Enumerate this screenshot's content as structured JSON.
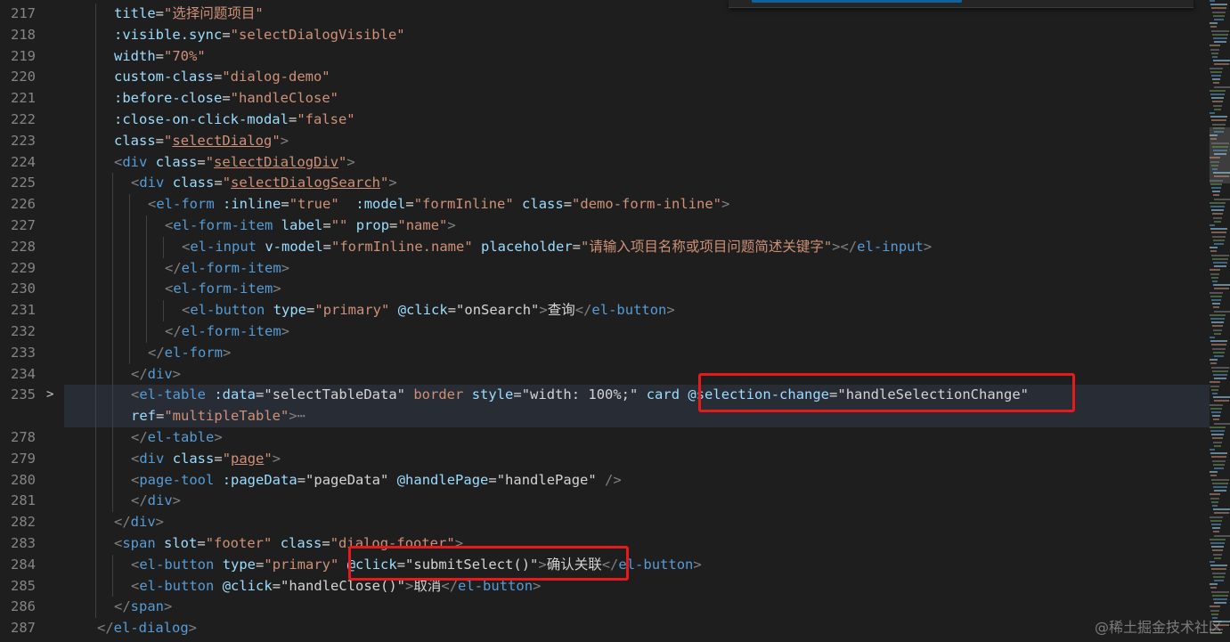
{
  "editor": {
    "lines": [
      {
        "num": "217",
        "fold": "",
        "indent": 2,
        "tokens": [
          {
            "c": "a",
            "t": "title"
          },
          {
            "c": "x",
            "t": "="
          },
          {
            "c": "s",
            "t": "\"选择问题项目\""
          }
        ]
      },
      {
        "num": "218",
        "fold": "",
        "indent": 2,
        "tokens": [
          {
            "c": "a",
            "t": ":visible.sync"
          },
          {
            "c": "x",
            "t": "="
          },
          {
            "c": "s",
            "t": "\"selectDialogVisible\""
          }
        ]
      },
      {
        "num": "219",
        "fold": "",
        "indent": 2,
        "tokens": [
          {
            "c": "a",
            "t": "width"
          },
          {
            "c": "x",
            "t": "="
          },
          {
            "c": "s",
            "t": "\"70%\""
          }
        ]
      },
      {
        "num": "220",
        "fold": "",
        "indent": 2,
        "tokens": [
          {
            "c": "a",
            "t": "custom-class"
          },
          {
            "c": "x",
            "t": "="
          },
          {
            "c": "s",
            "t": "\"dialog-demo\""
          }
        ]
      },
      {
        "num": "221",
        "fold": "",
        "indent": 2,
        "tokens": [
          {
            "c": "a",
            "t": ":before-close"
          },
          {
            "c": "x",
            "t": "="
          },
          {
            "c": "s",
            "t": "\"handleClose\""
          }
        ]
      },
      {
        "num": "222",
        "fold": "",
        "indent": 2,
        "tokens": [
          {
            "c": "a",
            "t": ":close-on-click-modal"
          },
          {
            "c": "x",
            "t": "="
          },
          {
            "c": "s",
            "t": "\"false\""
          }
        ]
      },
      {
        "num": "223",
        "fold": "",
        "indent": 2,
        "tokens": [
          {
            "c": "a",
            "t": "class"
          },
          {
            "c": "x",
            "t": "="
          },
          {
            "c": "s",
            "t": "\""
          },
          {
            "c": "s u",
            "t": "selectDialog"
          },
          {
            "c": "s",
            "t": "\""
          },
          {
            "c": "p",
            "t": ">"
          }
        ]
      },
      {
        "num": "224",
        "fold": "",
        "indent": 2,
        "tokens": [
          {
            "c": "p",
            "t": "<"
          },
          {
            "c": "t",
            "t": "div"
          },
          {
            "c": "x",
            "t": " "
          },
          {
            "c": "a",
            "t": "class"
          },
          {
            "c": "x",
            "t": "="
          },
          {
            "c": "s",
            "t": "\""
          },
          {
            "c": "s u",
            "t": "selectDialogDiv"
          },
          {
            "c": "s",
            "t": "\""
          },
          {
            "c": "p",
            "t": ">"
          }
        ]
      },
      {
        "num": "225",
        "fold": "",
        "indent": 3,
        "tokens": [
          {
            "c": "p",
            "t": "<"
          },
          {
            "c": "t",
            "t": "div"
          },
          {
            "c": "x",
            "t": " "
          },
          {
            "c": "a",
            "t": "class"
          },
          {
            "c": "x",
            "t": "="
          },
          {
            "c": "s",
            "t": "\""
          },
          {
            "c": "s u",
            "t": "selectDialogSearch"
          },
          {
            "c": "s",
            "t": "\""
          },
          {
            "c": "p",
            "t": ">"
          }
        ]
      },
      {
        "num": "226",
        "fold": "",
        "indent": 4,
        "tokens": [
          {
            "c": "p",
            "t": "<"
          },
          {
            "c": "t",
            "t": "el-form"
          },
          {
            "c": "x",
            "t": " "
          },
          {
            "c": "a",
            "t": ":inline"
          },
          {
            "c": "x",
            "t": "="
          },
          {
            "c": "s",
            "t": "\"true\""
          },
          {
            "c": "x",
            "t": "  "
          },
          {
            "c": "a",
            "t": ":model"
          },
          {
            "c": "x",
            "t": "="
          },
          {
            "c": "s",
            "t": "\"formInline\""
          },
          {
            "c": "x",
            "t": " "
          },
          {
            "c": "a",
            "t": "class"
          },
          {
            "c": "x",
            "t": "="
          },
          {
            "c": "s",
            "t": "\"demo-form-inline\""
          },
          {
            "c": "p",
            "t": ">"
          }
        ]
      },
      {
        "num": "227",
        "fold": "",
        "indent": 5,
        "tokens": [
          {
            "c": "p",
            "t": "<"
          },
          {
            "c": "t",
            "t": "el-form-item"
          },
          {
            "c": "x",
            "t": " "
          },
          {
            "c": "a",
            "t": "label"
          },
          {
            "c": "x",
            "t": "="
          },
          {
            "c": "s",
            "t": "\"\""
          },
          {
            "c": "x",
            "t": " "
          },
          {
            "c": "a",
            "t": "prop"
          },
          {
            "c": "x",
            "t": "="
          },
          {
            "c": "s",
            "t": "\"name\""
          },
          {
            "c": "p",
            "t": ">"
          }
        ]
      },
      {
        "num": "228",
        "fold": "",
        "indent": 6,
        "tokens": [
          {
            "c": "p",
            "t": "<"
          },
          {
            "c": "t",
            "t": "el-input"
          },
          {
            "c": "x",
            "t": " "
          },
          {
            "c": "a",
            "t": "v-model"
          },
          {
            "c": "x",
            "t": "="
          },
          {
            "c": "s",
            "t": "\"formInline.name\""
          },
          {
            "c": "x",
            "t": " "
          },
          {
            "c": "a",
            "t": "placeholder"
          },
          {
            "c": "x",
            "t": "="
          },
          {
            "c": "s",
            "t": "\"请输入项目名称或项目问题简述关键字\""
          },
          {
            "c": "p",
            "t": "></"
          },
          {
            "c": "t",
            "t": "el-input"
          },
          {
            "c": "p",
            "t": ">"
          }
        ]
      },
      {
        "num": "229",
        "fold": "",
        "indent": 5,
        "tokens": [
          {
            "c": "p",
            "t": "</"
          },
          {
            "c": "t",
            "t": "el-form-item"
          },
          {
            "c": "p",
            "t": ">"
          }
        ]
      },
      {
        "num": "230",
        "fold": "",
        "indent": 5,
        "tokens": [
          {
            "c": "p",
            "t": "<"
          },
          {
            "c": "t",
            "t": "el-form-item"
          },
          {
            "c": "p",
            "t": ">"
          }
        ]
      },
      {
        "num": "231",
        "fold": "",
        "indent": 6,
        "tokens": [
          {
            "c": "p",
            "t": "<"
          },
          {
            "c": "t",
            "t": "el-button"
          },
          {
            "c": "x",
            "t": " "
          },
          {
            "c": "a",
            "t": "type"
          },
          {
            "c": "x",
            "t": "="
          },
          {
            "c": "s",
            "t": "\"primary\""
          },
          {
            "c": "x",
            "t": " "
          },
          {
            "c": "a",
            "t": "@click"
          },
          {
            "c": "x",
            "t": "="
          },
          {
            "c": "x",
            "t": "\"onSearch\""
          },
          {
            "c": "p",
            "t": ">"
          },
          {
            "c": "x",
            "t": "查询"
          },
          {
            "c": "p",
            "t": "</"
          },
          {
            "c": "t",
            "t": "el-button"
          },
          {
            "c": "p",
            "t": ">"
          }
        ]
      },
      {
        "num": "232",
        "fold": "",
        "indent": 5,
        "tokens": [
          {
            "c": "p",
            "t": "</"
          },
          {
            "c": "t",
            "t": "el-form-item"
          },
          {
            "c": "p",
            "t": ">"
          }
        ]
      },
      {
        "num": "233",
        "fold": "",
        "indent": 4,
        "tokens": [
          {
            "c": "p",
            "t": "</"
          },
          {
            "c": "t",
            "t": "el-form"
          },
          {
            "c": "p",
            "t": ">"
          }
        ]
      },
      {
        "num": "234",
        "fold": "",
        "indent": 3,
        "tokens": [
          {
            "c": "p",
            "t": "</"
          },
          {
            "c": "t",
            "t": "div"
          },
          {
            "c": "p",
            "t": ">"
          }
        ]
      },
      {
        "num": "235",
        "fold": ">",
        "indent": 3,
        "highlight": true,
        "tokens": [
          {
            "c": "p",
            "t": "<"
          },
          {
            "c": "t",
            "t": "el-table"
          },
          {
            "c": "x",
            "t": " "
          },
          {
            "c": "a",
            "t": ":data"
          },
          {
            "c": "x",
            "t": "="
          },
          {
            "c": "x",
            "t": "\"selectTableData\""
          },
          {
            "c": "x",
            "t": " "
          },
          {
            "c": "s",
            "t": "border"
          },
          {
            "c": "x",
            "t": " "
          },
          {
            "c": "a",
            "t": "style"
          },
          {
            "c": "x",
            "t": "="
          },
          {
            "c": "x",
            "t": "\"width: 100%;\""
          },
          {
            "c": "x",
            "t": " "
          },
          {
            "c": "a",
            "t": "card"
          },
          {
            "c": "x",
            "t": " "
          },
          {
            "c": "a",
            "t": "@selection-change"
          },
          {
            "c": "x",
            "t": "="
          },
          {
            "c": "x",
            "t": "\"handleSelectionChange\""
          }
        ]
      },
      {
        "num": "",
        "fold": "",
        "indent": 3,
        "highlight": true,
        "tokens": [
          {
            "c": "a",
            "t": "ref"
          },
          {
            "c": "x",
            "t": "="
          },
          {
            "c": "s",
            "t": "\"multipleTable\""
          },
          {
            "c": "p",
            "t": ">"
          },
          {
            "c": "e",
            "t": "⋯"
          }
        ]
      },
      {
        "num": "278",
        "fold": "",
        "indent": 3,
        "tokens": [
          {
            "c": "p",
            "t": "</"
          },
          {
            "c": "t",
            "t": "el-table"
          },
          {
            "c": "p",
            "t": ">"
          }
        ]
      },
      {
        "num": "279",
        "fold": "",
        "indent": 3,
        "tokens": [
          {
            "c": "p",
            "t": "<"
          },
          {
            "c": "t",
            "t": "div"
          },
          {
            "c": "x",
            "t": " "
          },
          {
            "c": "a",
            "t": "class"
          },
          {
            "c": "x",
            "t": "="
          },
          {
            "c": "s",
            "t": "\""
          },
          {
            "c": "s u",
            "t": "page"
          },
          {
            "c": "s",
            "t": "\""
          },
          {
            "c": "p",
            "t": ">"
          }
        ]
      },
      {
        "num": "280",
        "fold": "",
        "indent": 3,
        "tokens": [
          {
            "c": "p",
            "t": "<"
          },
          {
            "c": "t",
            "t": "page-tool"
          },
          {
            "c": "x",
            "t": " "
          },
          {
            "c": "a",
            "t": ":pageData"
          },
          {
            "c": "x",
            "t": "="
          },
          {
            "c": "x",
            "t": "\"pageData\""
          },
          {
            "c": "x",
            "t": " "
          },
          {
            "c": "a",
            "t": "@handlePage"
          },
          {
            "c": "x",
            "t": "="
          },
          {
            "c": "x",
            "t": "\"handlePage\""
          },
          {
            "c": "x",
            "t": " "
          },
          {
            "c": "p",
            "t": "/>"
          }
        ]
      },
      {
        "num": "281",
        "fold": "",
        "indent": 3,
        "tokens": [
          {
            "c": "p",
            "t": "</"
          },
          {
            "c": "t",
            "t": "div"
          },
          {
            "c": "p",
            "t": ">"
          }
        ]
      },
      {
        "num": "282",
        "fold": "",
        "indent": 2,
        "tokens": [
          {
            "c": "p",
            "t": "</"
          },
          {
            "c": "t",
            "t": "div"
          },
          {
            "c": "p",
            "t": ">"
          }
        ]
      },
      {
        "num": "283",
        "fold": "",
        "indent": 2,
        "tokens": [
          {
            "c": "p",
            "t": "<"
          },
          {
            "c": "t",
            "t": "span"
          },
          {
            "c": "x",
            "t": " "
          },
          {
            "c": "a",
            "t": "slot"
          },
          {
            "c": "x",
            "t": "="
          },
          {
            "c": "s",
            "t": "\"footer\""
          },
          {
            "c": "x",
            "t": " "
          },
          {
            "c": "a",
            "t": "class"
          },
          {
            "c": "x",
            "t": "="
          },
          {
            "c": "s",
            "t": "\"dialog-footer\""
          },
          {
            "c": "p",
            "t": ">"
          }
        ]
      },
      {
        "num": "284",
        "fold": "",
        "indent": 3,
        "tokens": [
          {
            "c": "p",
            "t": "<"
          },
          {
            "c": "t",
            "t": "el-button"
          },
          {
            "c": "x",
            "t": " "
          },
          {
            "c": "a",
            "t": "type"
          },
          {
            "c": "x",
            "t": "="
          },
          {
            "c": "s",
            "t": "\"primary\""
          },
          {
            "c": "x",
            "t": " "
          },
          {
            "c": "a",
            "t": "@click"
          },
          {
            "c": "x",
            "t": "="
          },
          {
            "c": "x",
            "t": "\"submitSelect()\""
          },
          {
            "c": "p",
            "t": ">"
          },
          {
            "c": "x",
            "t": "确认关联"
          },
          {
            "c": "p",
            "t": "</"
          },
          {
            "c": "t",
            "t": "el-button"
          },
          {
            "c": "p",
            "t": ">"
          }
        ]
      },
      {
        "num": "285",
        "fold": "",
        "indent": 3,
        "tokens": [
          {
            "c": "p",
            "t": "<"
          },
          {
            "c": "t",
            "t": "el-button"
          },
          {
            "c": "x",
            "t": " "
          },
          {
            "c": "a",
            "t": "@click"
          },
          {
            "c": "x",
            "t": "="
          },
          {
            "c": "x",
            "t": "\"handleClose()\""
          },
          {
            "c": "p",
            "t": ">"
          },
          {
            "c": "x",
            "t": "取消"
          },
          {
            "c": "p",
            "t": "</"
          },
          {
            "c": "t",
            "t": "el-button"
          },
          {
            "c": "p",
            "t": ">"
          }
        ]
      },
      {
        "num": "286",
        "fold": "",
        "indent": 2,
        "tokens": [
          {
            "c": "p",
            "t": "</"
          },
          {
            "c": "t",
            "t": "span"
          },
          {
            "c": "p",
            "t": ">"
          }
        ]
      },
      {
        "num": "287",
        "fold": "",
        "indent": 1,
        "tokens": [
          {
            "c": "p",
            "t": "</"
          },
          {
            "c": "t",
            "t": "el-dialog"
          },
          {
            "c": "p",
            "t": ">"
          }
        ]
      }
    ]
  },
  "watermark": "@稀土掘金技术社区",
  "colors": {
    "background": "#1e1e1e",
    "tag": "#569cd6",
    "attribute": "#9cdcfe",
    "string": "#ce9178",
    "punctuation": "#808080",
    "line_number": "#858585",
    "annotation_box": "#e51b1b"
  }
}
